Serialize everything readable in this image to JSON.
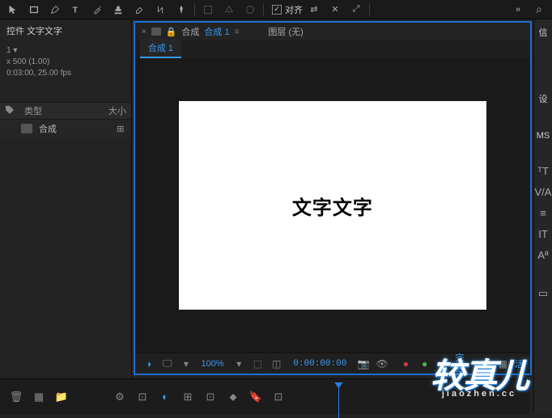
{
  "toolbar": {
    "align_label": "对齐"
  },
  "project": {
    "title": "控件 文字文字",
    "line1": "1 ▾",
    "line2": "x 500 (1.00)",
    "line3": "0:03:00, 25.00 fps"
  },
  "list": {
    "col_tag": "",
    "col_type": "类型",
    "col_size": "大小",
    "item1_label": "合成"
  },
  "viewer": {
    "tab_prefix": "合成",
    "tab_active": "合成 1",
    "layer_label": "图层 (无)",
    "sub_tab": "合成 1",
    "canvas_text": "文字文字"
  },
  "footer": {
    "zoom": "100%",
    "timecode": "0:00:00:00",
    "complete": "完整",
    "active": "活"
  },
  "right": {
    "tab1": "信",
    "tab2": "设",
    "tab3": "MS"
  },
  "watermark": {
    "main": "较真儿",
    "sub": "jiaozhen.cc"
  }
}
